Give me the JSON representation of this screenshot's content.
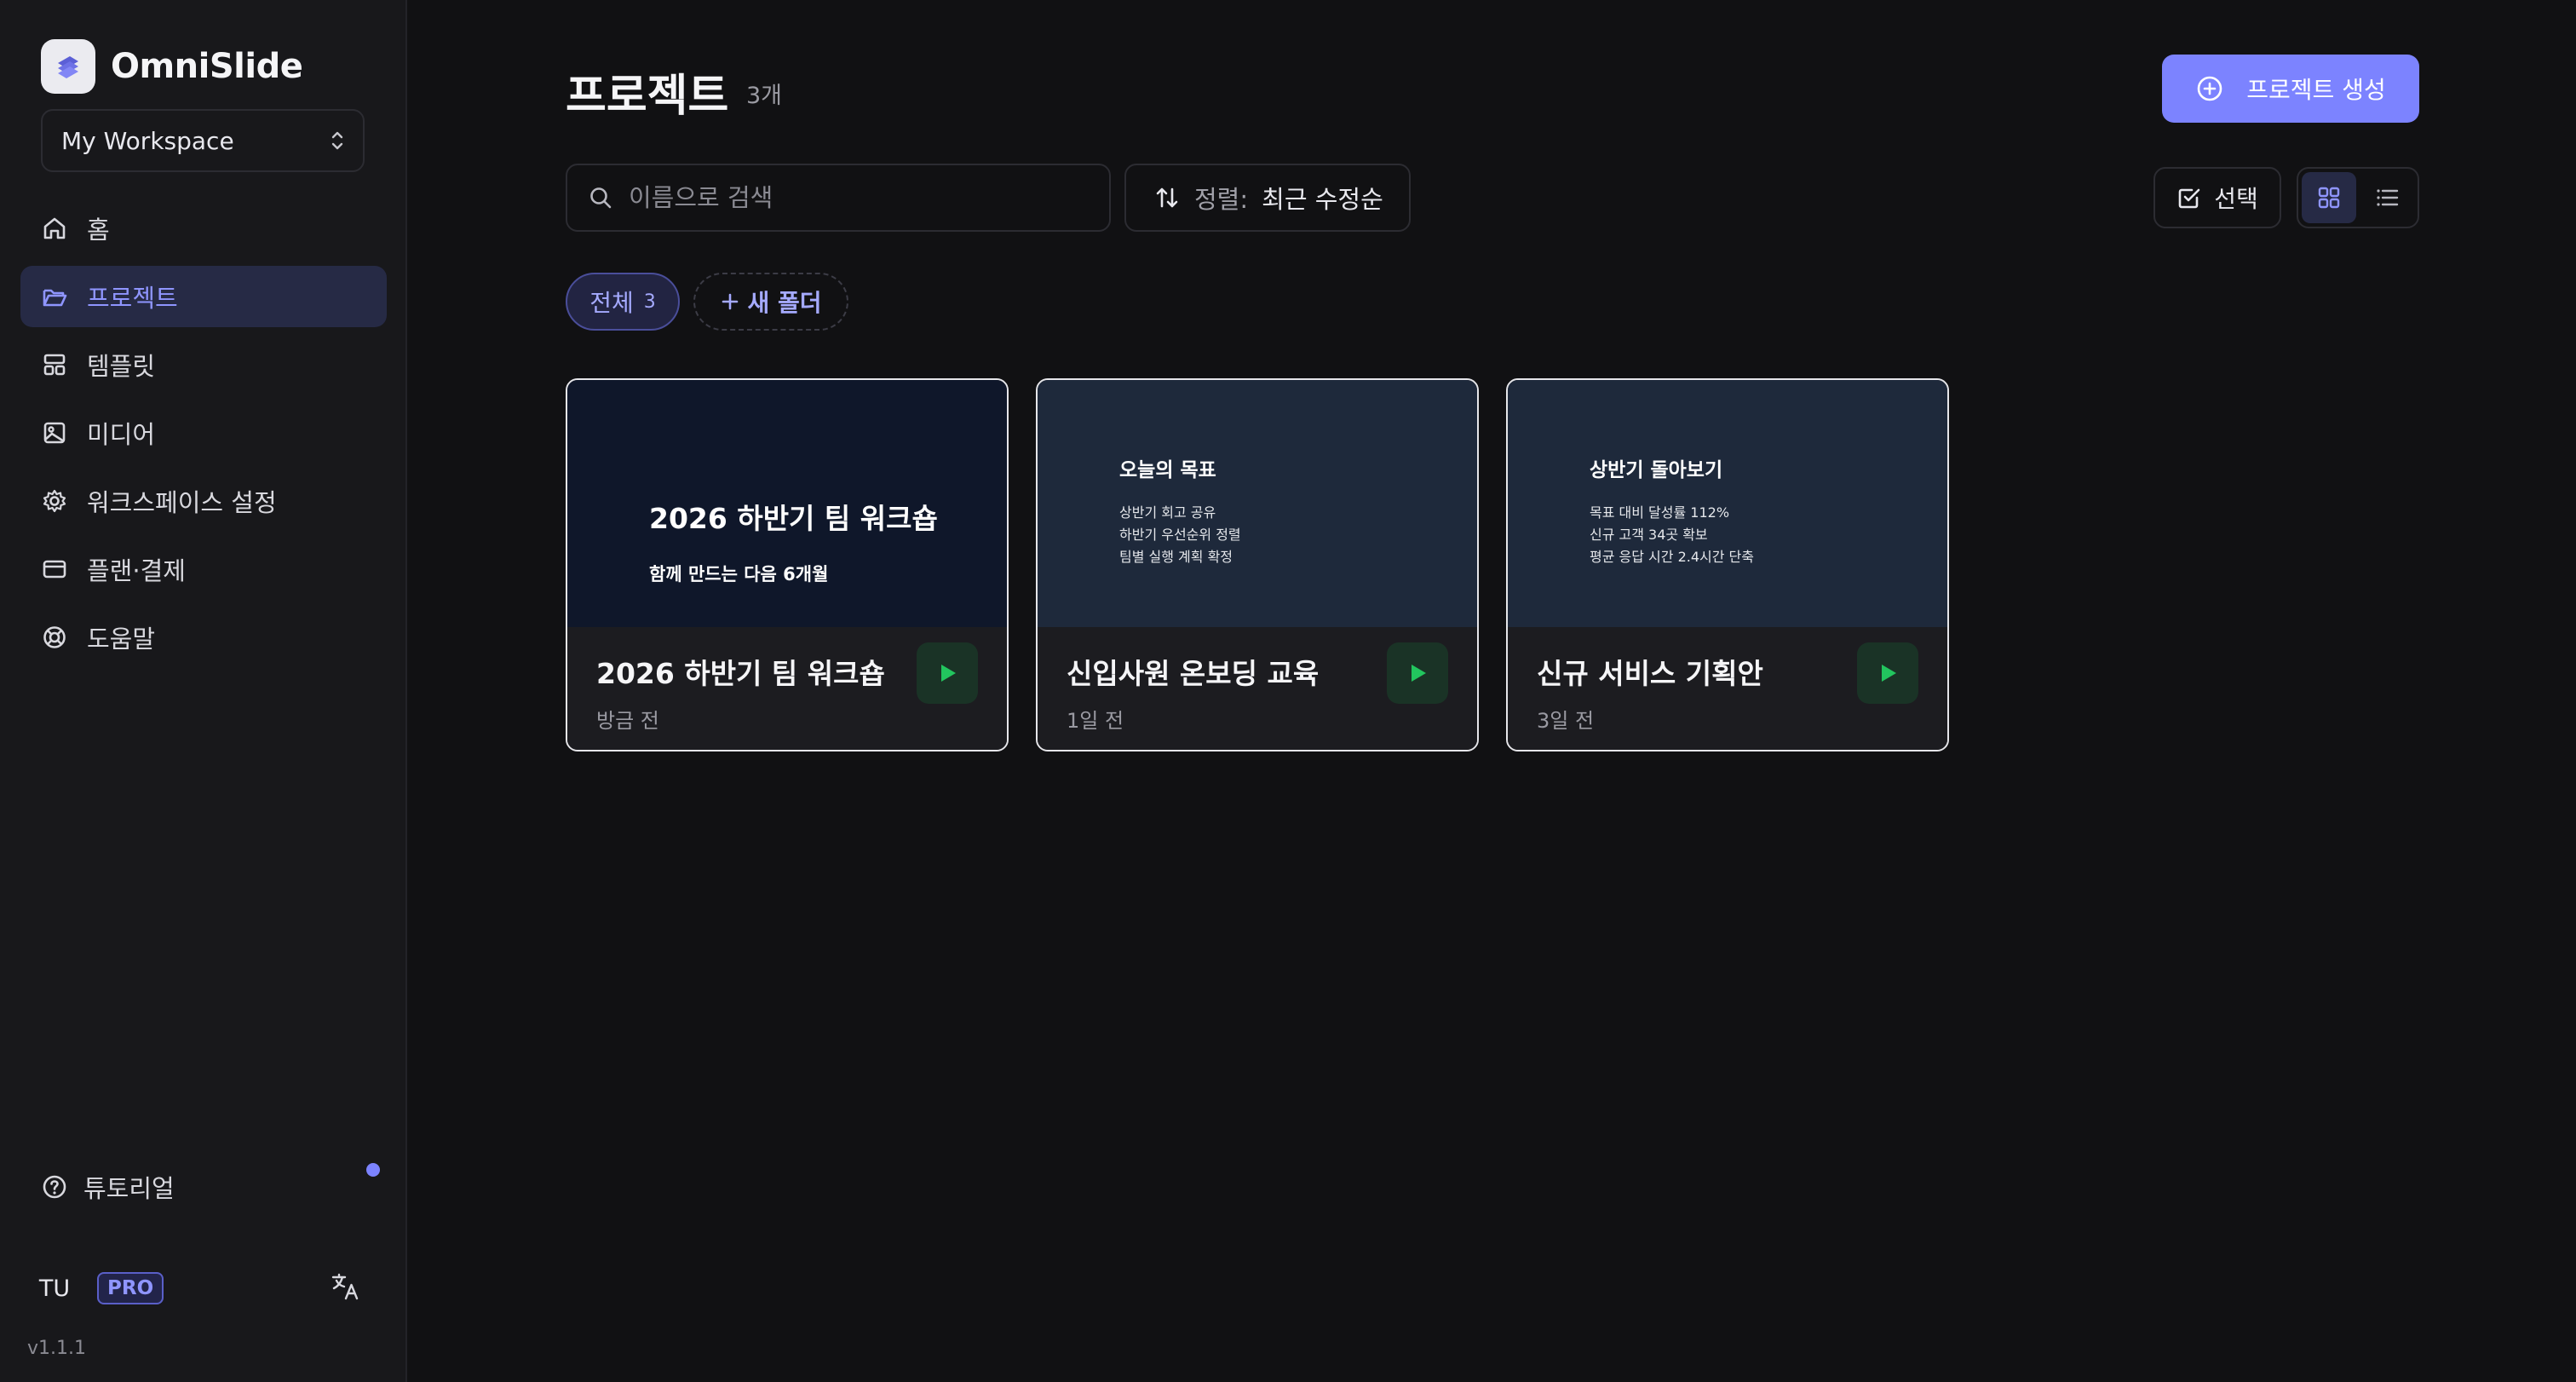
{
  "brand": {
    "name": "OmniSlide"
  },
  "workspace": {
    "selected": "My Workspace"
  },
  "nav": {
    "home": "홈",
    "projects": "프로젝트",
    "templates": "템플릿",
    "media": "미디어",
    "workspace_settings": "워크스페이스 설정",
    "billing": "플랜·결제",
    "help": "도움말"
  },
  "tutorial": {
    "label": "튜토리얼"
  },
  "user": {
    "initials": "TU",
    "plan": "PRO"
  },
  "version": "v1.1.1",
  "header": {
    "title": "프로젝트",
    "count": "3개",
    "create_label": "프로젝트 생성"
  },
  "toolbar": {
    "search_placeholder": "이름으로 검색",
    "sort_prefix": "정렬:",
    "sort_value": "최근 수정순",
    "select_label": "선택"
  },
  "folders": {
    "all_label": "전체",
    "all_count": "3",
    "new_folder_label": "새 폴더"
  },
  "projects": [
    {
      "name": "2026 하반기 팀 워크숍",
      "time": "방금 전",
      "thumb_title": "2026 하반기 팀 워크숍",
      "thumb_subtitle": "함께 만드는 다음 6개월"
    },
    {
      "name": "신입사원 온보딩 교육",
      "time": "1일 전",
      "thumb_title": "오늘의 목표",
      "thumb_lines": [
        "상반기 회고 공유",
        "하반기 우선순위 정렬",
        "팀별 실행 계획 확정"
      ]
    },
    {
      "name": "신규 서비스 기획안",
      "time": "3일 전",
      "thumb_title": "상반기 돌아보기",
      "thumb_lines": [
        "목표 대비 달성률 112%",
        "신규 고객 34곳 확보",
        "평균 응답 시간 2.4시간 단축"
      ]
    }
  ],
  "colors": {
    "accent": "#7c83ff",
    "play": "#22c55e",
    "background": "#111113",
    "sidebar": "#18181b"
  }
}
